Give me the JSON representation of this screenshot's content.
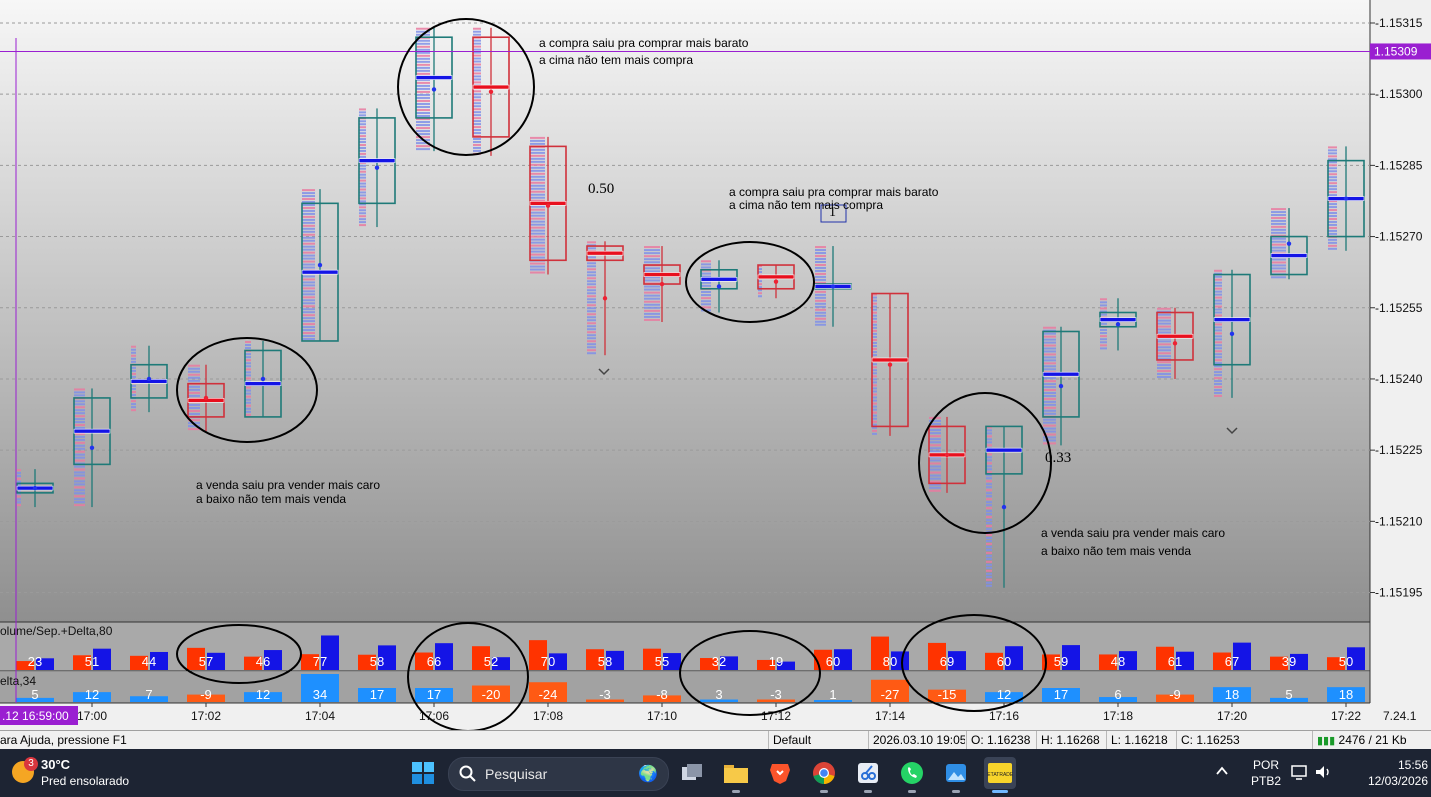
{
  "chart": {
    "price_axis": [
      "1.15315",
      "1.15300",
      "1.15285",
      "1.15270",
      "1.15255",
      "1.15240",
      "1.15225",
      "1.15210",
      "1.15195"
    ],
    "current_price": "1.15309",
    "time_axis": [
      "17:00",
      "17:02",
      "17:04",
      "17:06",
      "17:08",
      "17:10",
      "17:12",
      "17:14",
      "17:16",
      "17:18",
      "17:20",
      "17:22"
    ],
    "crosshair_time": ".12 16:59:00",
    "version": "7.24.1",
    "indicator1_label": "olume/Sep.+Delta,80",
    "indicator2_label": "elta,34",
    "annotations": {
      "buy_top_1": "a compra saiu pra comprar mais barato\na cima não tem mais compra",
      "buy_top_2": "a compra saiu pra comprar mais barato\na cima não tem mais compra",
      "sell_bottom_1": "a venda saiu pra vender mais caro\na baixo não tem mais venda",
      "sell_bottom_2": "a venda saiu pra vender mais caro\na baixo não tem mais venda"
    },
    "value_labels": [
      "0.50",
      "0.33",
      "1"
    ],
    "colors": {
      "up": "#1e7a78",
      "down": "#d0313b",
      "buy": "#1414e6",
      "sell": "#ff3300",
      "delta_pos": "#1e90ff",
      "delta_neg": "#ff5a14",
      "line": "#9a1fd1"
    }
  },
  "chart_data": {
    "type": "candlestick-footprint",
    "candles": [
      {
        "o": 1.15216,
        "h": 1.15221,
        "l": 1.15213,
        "c": 1.15218,
        "vol": 23,
        "delta": 5
      },
      {
        "o": 1.15222,
        "h": 1.15238,
        "l": 1.15213,
        "c": 1.15236,
        "vol": 51,
        "delta": 12
      },
      {
        "o": 1.15236,
        "h": 1.15247,
        "l": 1.15233,
        "c": 1.15243,
        "vol": 44,
        "delta": 7
      },
      {
        "o": 1.15239,
        "h": 1.15243,
        "l": 1.15229,
        "c": 1.15232,
        "vol": 57,
        "delta": -9
      },
      {
        "o": 1.15232,
        "h": 1.15248,
        "l": 1.15232,
        "c": 1.15246,
        "vol": 46,
        "delta": 12
      },
      {
        "o": 1.15248,
        "h": 1.1528,
        "l": 1.15248,
        "c": 1.15277,
        "vol": 77,
        "delta": 34
      },
      {
        "o": 1.15277,
        "h": 1.15297,
        "l": 1.15272,
        "c": 1.15295,
        "vol": 58,
        "delta": 17
      },
      {
        "o": 1.15295,
        "h": 1.15314,
        "l": 1.15288,
        "c": 1.15312,
        "vol": 66,
        "delta": 17
      },
      {
        "o": 1.15312,
        "h": 1.15314,
        "l": 1.15287,
        "c": 1.15291,
        "vol": 52,
        "delta": -20
      },
      {
        "o": 1.15289,
        "h": 1.15291,
        "l": 1.15262,
        "c": 1.15265,
        "vol": 70,
        "delta": -24
      },
      {
        "o": 1.15268,
        "h": 1.15269,
        "l": 1.15245,
        "c": 1.15265,
        "vol": 58,
        "delta": -3
      },
      {
        "o": 1.15264,
        "h": 1.15268,
        "l": 1.15252,
        "c": 1.1526,
        "vol": 55,
        "delta": -8
      },
      {
        "o": 1.15259,
        "h": 1.15265,
        "l": 1.15254,
        "c": 1.15263,
        "vol": 32,
        "delta": 3
      },
      {
        "o": 1.15264,
        "h": 1.15264,
        "l": 1.15257,
        "c": 1.15259,
        "vol": 19,
        "delta": -3
      },
      {
        "o": 1.15259,
        "h": 1.15268,
        "l": 1.15251,
        "c": 1.1526,
        "vol": 60,
        "delta": 1
      },
      {
        "o": 1.15258,
        "h": 1.15258,
        "l": 1.15228,
        "c": 1.1523,
        "vol": 80,
        "delta": -27
      },
      {
        "o": 1.1523,
        "h": 1.15232,
        "l": 1.15216,
        "c": 1.15218,
        "vol": 69,
        "delta": -15
      },
      {
        "o": 1.1522,
        "h": 1.1523,
        "l": 1.15196,
        "c": 1.1523,
        "vol": 60,
        "delta": 12
      },
      {
        "o": 1.15232,
        "h": 1.15251,
        "l": 1.15226,
        "c": 1.1525,
        "vol": 59,
        "delta": 17
      },
      {
        "o": 1.15251,
        "h": 1.15257,
        "l": 1.15246,
        "c": 1.15254,
        "vol": 48,
        "delta": 6
      },
      {
        "o": 1.15254,
        "h": 1.15255,
        "l": 1.1524,
        "c": 1.15244,
        "vol": 61,
        "delta": -9
      },
      {
        "o": 1.15243,
        "h": 1.15263,
        "l": 1.15236,
        "c": 1.15262,
        "vol": 67,
        "delta": 18
      },
      {
        "o": 1.15262,
        "h": 1.15276,
        "l": 1.15261,
        "c": 1.1527,
        "vol": 39,
        "delta": 5
      },
      {
        "o": 1.1527,
        "h": 1.15289,
        "l": 1.15267,
        "c": 1.15286,
        "vol": 50,
        "delta": 18
      }
    ],
    "ylim": [
      1.15189,
      1.15319
    ]
  },
  "statusbar": {
    "help": "ara Ajuda, pressione F1",
    "profile": "Default",
    "datetime": "2026.03.10 19:05",
    "open": "O: 1.16238",
    "high": "H: 1.16268",
    "low": "L: 1.16218",
    "close": "C: 1.16253",
    "traffic": "2476 / 21 Kb"
  },
  "taskbar": {
    "weather_temp": "30°C",
    "weather_desc": "Pred ensolarado",
    "weather_badge": "3",
    "search_placeholder": "Pesquisar",
    "lang1": "POR",
    "lang2": "PTB2",
    "time": "15:56",
    "date": "12/03/2026",
    "apps": [
      "task-view",
      "file-explorer",
      "brave",
      "chrome",
      "snipping-tool",
      "whatsapp",
      "photos",
      "metatrader"
    ]
  }
}
